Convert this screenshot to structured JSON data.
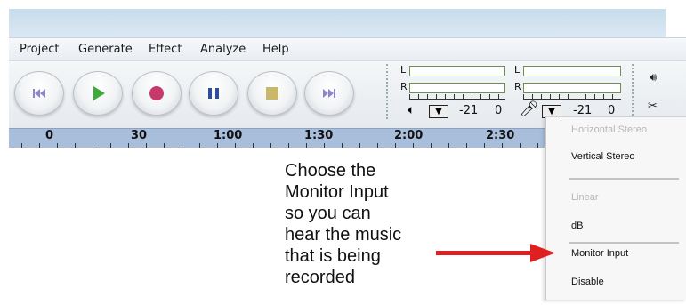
{
  "menu": [
    "Project",
    "Generate",
    "Effect",
    "Analyze",
    "Help"
  ],
  "transport": [
    {
      "name": "skip-to-start-icon",
      "color": "#8d86c9"
    },
    {
      "name": "play-icon",
      "color": "#3faa3a"
    },
    {
      "name": "record-icon",
      "color": "#c8386b"
    },
    {
      "name": "pause-icon",
      "color": "#2e4d9c"
    },
    {
      "name": "stop-icon",
      "color": "#c9b86c"
    },
    {
      "name": "skip-to-end-icon",
      "color": "#8d86c9"
    }
  ],
  "playback_meter": {
    "left_label": "L",
    "right_label": "R",
    "level1": "-21",
    "level2": "0"
  },
  "recording_meter": {
    "left_label": "L",
    "right_label": "R",
    "level1": "-21",
    "level2": "0"
  },
  "ruler": [
    "0",
    "30",
    "1:00",
    "1:30",
    "2:00",
    "2:30"
  ],
  "dropdown": {
    "items": [
      {
        "label": "Horizontal Stereo",
        "disabled": true
      },
      {
        "label": "Vertical Stereo",
        "disabled": false
      },
      {
        "label": "Linear",
        "disabled": true
      },
      {
        "label": "dB",
        "disabled": false
      },
      {
        "label": "Monitor Input",
        "disabled": false
      },
      {
        "label": "Disable",
        "disabled": false
      }
    ]
  },
  "callout": {
    "lines": [
      "Choose the",
      "Monitor Input",
      "so you can",
      "hear the music",
      "that is being",
      "recorded"
    ],
    "arrow_color": "#e02020"
  }
}
